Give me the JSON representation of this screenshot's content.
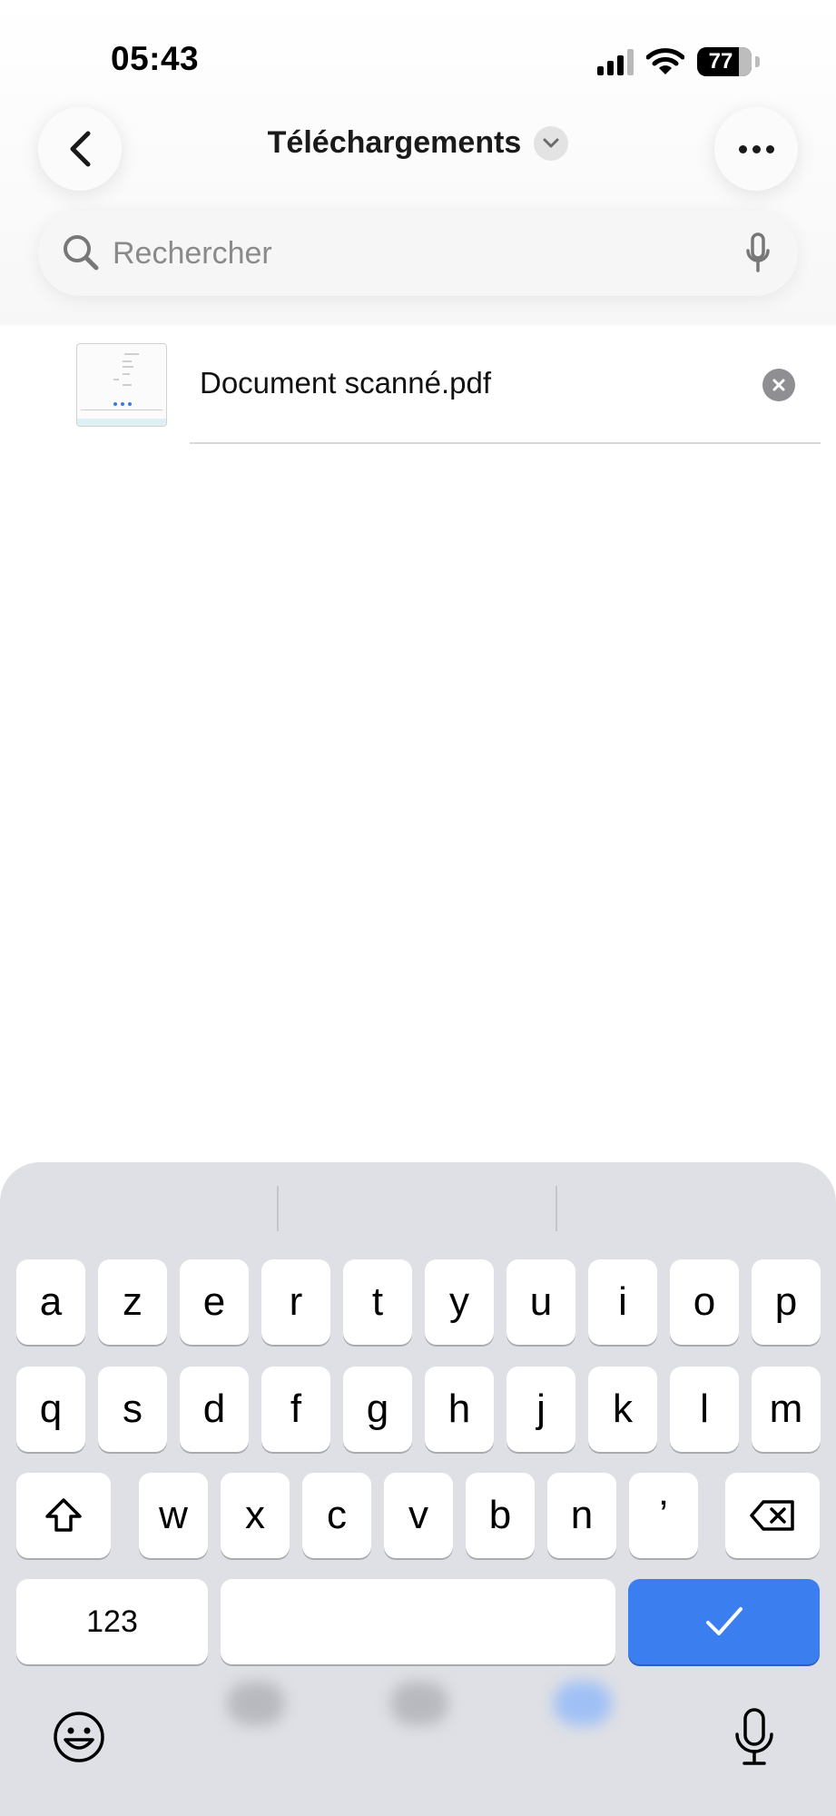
{
  "status_bar": {
    "time": "05:43",
    "battery": "77",
    "icons": [
      "cellular-signal-icon",
      "wifi-icon",
      "battery-icon"
    ]
  },
  "header": {
    "title": "Téléchargements",
    "icons": [
      "back-chevron-icon",
      "chevron-down-icon",
      "more-ellipsis-icon"
    ]
  },
  "search": {
    "placeholder": "Rechercher",
    "value": "",
    "icons": [
      "search-icon",
      "microphone-icon"
    ]
  },
  "file": {
    "name": "Document scanné.pdf",
    "icons": [
      "pdf-thumbnail",
      "clear-text-icon"
    ]
  },
  "keyboard": {
    "row1": [
      "a",
      "z",
      "e",
      "r",
      "t",
      "y",
      "u",
      "i",
      "o",
      "p"
    ],
    "row2": [
      "q",
      "s",
      "d",
      "f",
      "g",
      "h",
      "j",
      "k",
      "l",
      "m"
    ],
    "row3": [
      "w",
      "x",
      "c",
      "v",
      "b",
      "n",
      "’"
    ],
    "numbers_key": "123",
    "space_key": "",
    "icons": [
      "shift-icon",
      "backspace-icon",
      "checkmark-icon",
      "emoji-icon",
      "dictation-microphone-icon"
    ],
    "done_color": "#3b7ef0"
  }
}
